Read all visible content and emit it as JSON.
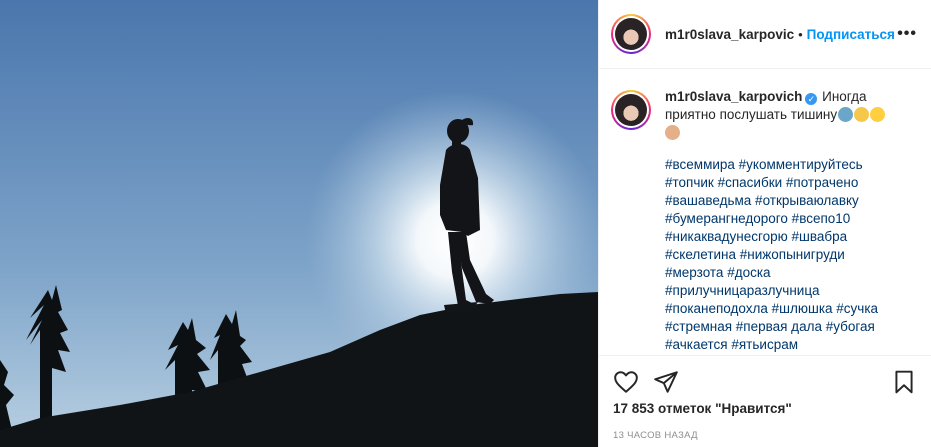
{
  "post": {
    "username": "m1r0slava_karpovich",
    "header_username": "m1r0slava_karpovic",
    "separator": "•",
    "follow_label": "Подписаться",
    "more_label": "•••",
    "verified_mark": "✓",
    "caption": "Иногда приятно послушать тишину",
    "caption_emojis": [
      "person-in-lotus-emoji",
      "sparkles-emoji",
      "smiling-halo-emoji",
      "praying-hands-emoji"
    ],
    "hashtags": [
      "#всеммира #укомментируйтесь",
      "#топчик #спасибки #потрачено",
      "#вашаведьма #открываюлавку",
      "#бумерангнедорого #всепо10",
      "#никаквадунесгорю #швабра",
      "#скелетина #нижопынигруди",
      "#мерзота #доска",
      "#прилучницаразлучница",
      "#поканеподохла #шлюшка #сучка",
      "#стремная #первая дала #убогая",
      "#ачкается #ятьисрам"
    ],
    "likes_text": "17 853 отметок \"Нравится\"",
    "time_ago": "13 ЧАСОВ НАЗАД"
  },
  "icons": {
    "like": "heart-icon",
    "share": "paper-plane-icon",
    "save": "bookmark-icon",
    "more": "more-dots-icon"
  },
  "colors": {
    "follow": "#0095f6",
    "hashtag": "#00376b",
    "verified": "#3897f0",
    "sky_top": "#4a76ad",
    "sky_glow": "#e9f1f7"
  }
}
